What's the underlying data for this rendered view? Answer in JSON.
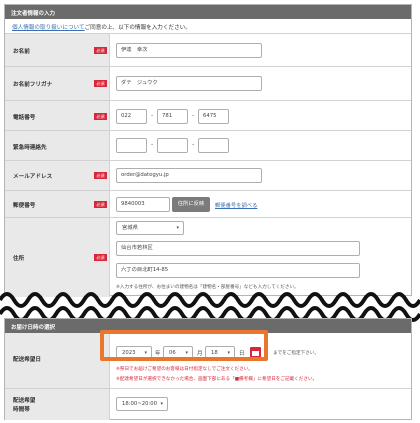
{
  "orderer_section": {
    "title": "注文者情報の入力",
    "notice_link": "個人情報の取り扱いについて",
    "notice_text": "ご同意の上、以下の情報を入力ください。",
    "required_badge": "必須",
    "fields": {
      "name": {
        "label": "お名前",
        "value": "伊達　幸次"
      },
      "furigana": {
        "label": "お名前フリガナ",
        "value": "ダテ　ジュウク"
      },
      "phone": {
        "label": "電話番号",
        "part1": "022",
        "part2": "781",
        "part3": "6475"
      },
      "emergency": {
        "label": "緊急時連絡先"
      },
      "email": {
        "label": "メールアドレス",
        "value": "order@dategyu.jp"
      },
      "postal": {
        "label": "郵便番号",
        "value": "9840003",
        "convert_button": "住所に反映",
        "lookup_link": "郵便番号を調べる"
      },
      "address": {
        "label": "住所",
        "prefecture": "宮城県",
        "city": "仙台市若林区",
        "street": "六丁の目北町14-85",
        "note": "※入力する住所が、お住まいの建物名は「建物名・部屋番号」なども入力してください。"
      }
    }
  },
  "delivery_section": {
    "title": "お届け日時の選択",
    "date": {
      "label": "配送希望日",
      "year": "2023",
      "year_unit": "年",
      "month": "06",
      "month_unit": "月",
      "day": "18",
      "day_unit": "日",
      "note_top": "までをご指定下さい。",
      "note1": "※祭日でお届けご希望のお客様は日付指定なしでご注文ください。",
      "note2": "※配達希望日が選択できなかった場合、画面下部にある「■備考欄」に希望日をご記載ください。"
    },
    "time": {
      "label": "配送希望",
      "label2": "時間帯",
      "value": "18:00~20:00"
    }
  },
  "colors": {
    "header_bg": "#6b6b6b",
    "required_badge": "#d7273a",
    "highlight": "#e8762c",
    "link": "#3a6fb5"
  }
}
